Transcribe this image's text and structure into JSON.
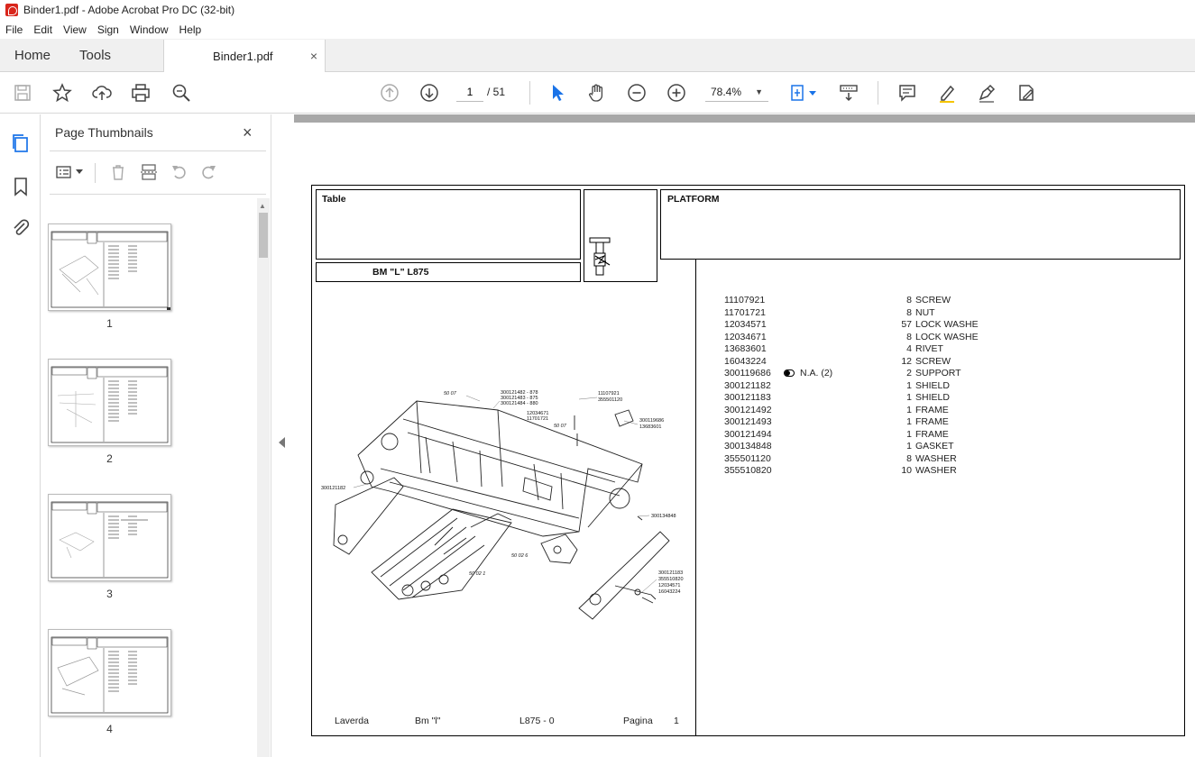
{
  "window": {
    "title": "Binder1.pdf - Adobe Acrobat Pro DC (32-bit)"
  },
  "menu": [
    "File",
    "Edit",
    "View",
    "Sign",
    "Window",
    "Help"
  ],
  "tabs": {
    "home": "Home",
    "tools": "Tools",
    "document": "Binder1.pdf",
    "close": "×"
  },
  "toolbar": {
    "current_page": "1",
    "total_pages": "/ 51",
    "zoom": "78.4%"
  },
  "panel": {
    "title": "Page Thumbnails",
    "close": "×"
  },
  "thumbnails": [
    {
      "label": "1"
    },
    {
      "label": "2"
    },
    {
      "label": "3"
    },
    {
      "label": "4"
    }
  ],
  "document": {
    "table_label": "Table",
    "section_title": "PLATFORM",
    "model": "BM \"L\"  L875",
    "callouts": {
      "c1": "50 07",
      "c2": "300121482 - 878",
      "c3": "300121483 - 875",
      "c4": "300121484 - 880",
      "c5": "11107921",
      "c6": "355501120",
      "c7": "12034671",
      "c8": "11701721",
      "c9": "50 07",
      "c10": "300119686",
      "c11": "13683601",
      "c12": "300121182",
      "c13": "300134848",
      "c14": "50 02 6",
      "c15": "50 02 1",
      "c16": "300121183",
      "c17": "355510820",
      "c18": "12034571",
      "c19": "16043224"
    },
    "parts": [
      {
        "pn": "11107921",
        "note": "",
        "qty": "8",
        "desc": "SCREW"
      },
      {
        "pn": "11701721",
        "note": "",
        "qty": "8",
        "desc": "NUT"
      },
      {
        "pn": "12034571",
        "note": "",
        "qty": "57",
        "desc": "LOCK WASHE"
      },
      {
        "pn": "12034671",
        "note": "",
        "qty": "8",
        "desc": "LOCK WASHE"
      },
      {
        "pn": "13683601",
        "note": "",
        "qty": "4",
        "desc": "RIVET"
      },
      {
        "pn": "16043224",
        "note": "",
        "qty": "12",
        "desc": "SCREW"
      },
      {
        "pn": "300119686",
        "note": "N.A.  (2)",
        "qty": "2",
        "desc": "SUPPORT"
      },
      {
        "pn": "300121182",
        "note": "",
        "qty": "1",
        "desc": "SHIELD"
      },
      {
        "pn": "300121183",
        "note": "",
        "qty": "1",
        "desc": "SHIELD"
      },
      {
        "pn": "300121492",
        "note": "",
        "qty": "1",
        "desc": "FRAME"
      },
      {
        "pn": "300121493",
        "note": "",
        "qty": "1",
        "desc": "FRAME"
      },
      {
        "pn": "300121494",
        "note": "",
        "qty": "1",
        "desc": "FRAME"
      },
      {
        "pn": "300134848",
        "note": "",
        "qty": "1",
        "desc": "GASKET"
      },
      {
        "pn": "355501120",
        "note": "",
        "qty": "8",
        "desc": "WASHER"
      },
      {
        "pn": "355510820",
        "note": "",
        "qty": "10",
        "desc": "WASHER"
      }
    ],
    "footer": {
      "brand": "Laverda",
      "model": "Bm \"l\"",
      "code": "L875 - 0",
      "page_label": "Pagina",
      "page_num": "1"
    }
  }
}
